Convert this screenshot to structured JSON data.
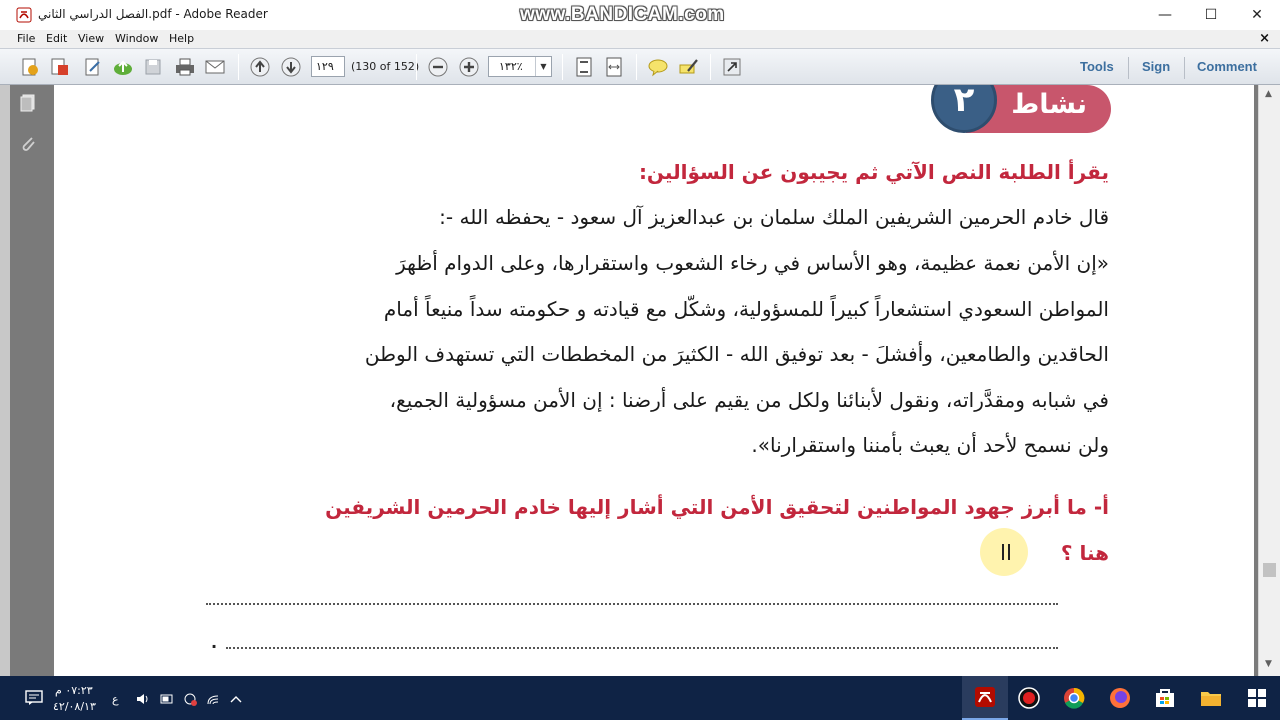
{
  "window": {
    "title": "الفصل الدراسي الثاني.pdf - Adobe Reader",
    "watermark": "www.BANDICAM.com",
    "min_glyph": "—",
    "max_glyph": "☐",
    "close_glyph": "✕"
  },
  "menu": {
    "items": [
      "File",
      "Edit",
      "View",
      "Window",
      "Help"
    ],
    "close_glyph": "×"
  },
  "toolbar": {
    "page_value": "١٢٩",
    "page_count": "(130 of 152)",
    "zoom_value": "١٣٢٪",
    "zoom_arrow": "▼",
    "tools_label": "Tools",
    "sign_label": "Sign",
    "comment_label": "Comment"
  },
  "page": {
    "badge_label": "نشاط",
    "badge_number": "٢",
    "instruction": "يقرأ الطلبة النص الآتي ثم يجيبون عن السؤالين:",
    "lines": [
      "قال خادم الحرمين الشريفين الملك سلمان بن عبدالعزيز آل سعود - يحفظه الله -:",
      "«إن الأمن نعمة عظيمة، وهو الأساس في رخاء الشعوب واستقرارها، وعلى الدوام أظهرَ",
      "المواطن السعودي استشعاراً كبيراً للمسؤولية، وشكّل مع قيادته و حكومته سداً منيعاً أمام",
      "الحاقدين والطامعين، وأفشلَ - بعد توفيق الله - الكثيرَ من المخططات التي تستهدف الوطن",
      "في شبابه ومقدَّراته، ونقول لأبنائنا ولكل من يقيم على أرضنا : إن الأمن مسؤولية الجميع،",
      "ولن نسمح لأحد أن يعبث بأمننا واستقرارنا»."
    ],
    "question_line1": "أ- ما أبرز جهود المواطنين لتحقيق الأمن التي أشار إليها خادم الحرمين الشريفين",
    "question_line2": "هنا ؟",
    "trailing_dot": "."
  },
  "taskbar": {
    "time": "٠٧:٢٣ م",
    "date": "٤٢/٠٨/١٣",
    "lang": "ع"
  },
  "colors": {
    "accent_red": "#c2273d",
    "badge_pink": "#c8566c",
    "badge_blue": "#3a5f86",
    "link_blue": "#3c6f9f",
    "taskbar": "#0f2345"
  }
}
